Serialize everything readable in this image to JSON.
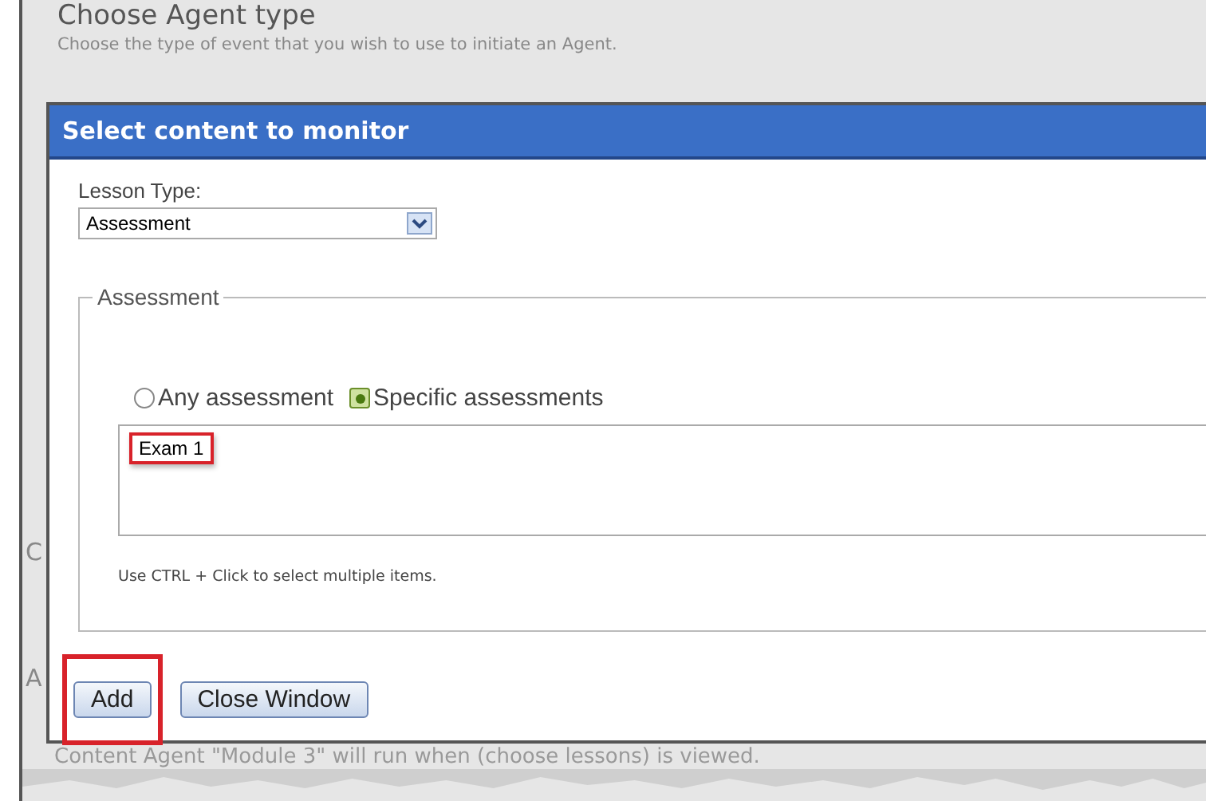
{
  "background_page": {
    "heading": "Choose Agent type",
    "description": "Choose the type of event that you wish to use to initiate an Agent.",
    "side_letter_1": "C",
    "side_letter_2": "A",
    "footer_text": "Content Agent \"Module 3\" will run when (choose lessons) is viewed."
  },
  "dialog": {
    "title": "Select content to monitor",
    "lesson_type": {
      "label": "Lesson Type:",
      "value": "Assessment"
    },
    "group": {
      "legend": "Assessment",
      "radios": [
        {
          "label": "Any assessment",
          "selected": false
        },
        {
          "label": "Specific assessments",
          "selected": true
        }
      ],
      "list_items": [
        {
          "label": "Exam 1",
          "highlighted": true
        }
      ],
      "hint": "Use CTRL + Click to select multiple items."
    },
    "buttons": [
      {
        "label": "Add",
        "highlighted": true
      },
      {
        "label": "Close Window",
        "highlighted": false
      }
    ]
  }
}
